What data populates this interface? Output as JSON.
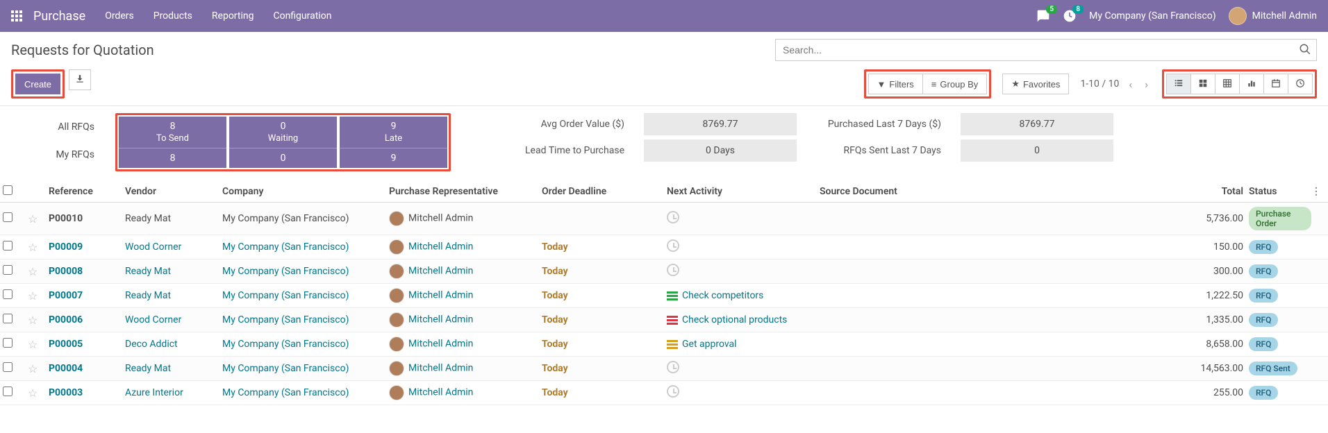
{
  "topbar": {
    "brand": "Purchase",
    "menu": [
      "Orders",
      "Products",
      "Reporting",
      "Configuration"
    ],
    "msg_badge": "5",
    "activity_badge": "8",
    "company": "My Company (San Francisco)",
    "user": "Mitchell Admin"
  },
  "cp": {
    "title": "Requests for Quotation",
    "search_placeholder": "Search...",
    "create": "Create",
    "filters": "Filters",
    "groupby": "Group By",
    "favorites": "Favorites",
    "pager": "1-10 / 10"
  },
  "dash": {
    "left": [
      "All RFQs",
      "My RFQs"
    ],
    "tiles": [
      {
        "big": "8",
        "label": "To Send",
        "sub": "8"
      },
      {
        "big": "0",
        "label": "Waiting",
        "sub": "0"
      },
      {
        "big": "9",
        "label": "Late",
        "sub": "9"
      }
    ],
    "metrics": [
      {
        "label": "Avg Order Value ($)",
        "val": "8769.77"
      },
      {
        "label": "Purchased Last 7 Days ($)",
        "val": "8769.77"
      },
      {
        "label": "Lead Time to Purchase",
        "val": "0  Days"
      },
      {
        "label": "RFQs Sent Last 7 Days",
        "val": "0"
      }
    ]
  },
  "table": {
    "headers": [
      "Reference",
      "Vendor",
      "Company",
      "Purchase Representative",
      "Order Deadline",
      "Next Activity",
      "Source Document",
      "Total",
      "Status"
    ],
    "rows": [
      {
        "ref": "P00010",
        "ref_link": false,
        "vendor": "Ready Mat",
        "vendor_link": false,
        "company": "My Company (San Francisco)",
        "company_link": false,
        "rep": "Mitchell Admin",
        "rep_link": false,
        "deadline": "",
        "deadline_today": false,
        "activity": "",
        "activity_type": "clock",
        "source": "",
        "total": "5,736.00",
        "status": "Purchase Order",
        "status_class": "po"
      },
      {
        "ref": "P00009",
        "ref_link": true,
        "vendor": "Wood Corner",
        "vendor_link": true,
        "company": "My Company (San Francisco)",
        "company_link": true,
        "rep": "Mitchell Admin",
        "rep_link": true,
        "deadline": "Today",
        "deadline_today": true,
        "activity": "",
        "activity_type": "clock",
        "source": "",
        "total": "150.00",
        "status": "RFQ",
        "status_class": "rfq"
      },
      {
        "ref": "P00008",
        "ref_link": true,
        "vendor": "Ready Mat",
        "vendor_link": true,
        "company": "My Company (San Francisco)",
        "company_link": true,
        "rep": "Mitchell Admin",
        "rep_link": true,
        "deadline": "Today",
        "deadline_today": true,
        "activity": "",
        "activity_type": "clock",
        "source": "",
        "total": "300.00",
        "status": "RFQ",
        "status_class": "rfq"
      },
      {
        "ref": "P00007",
        "ref_link": true,
        "vendor": "Ready Mat",
        "vendor_link": true,
        "company": "My Company (San Francisco)",
        "company_link": true,
        "rep": "Mitchell Admin",
        "rep_link": true,
        "deadline": "Today",
        "deadline_today": true,
        "activity": "Check competitors",
        "activity_type": "green",
        "source": "",
        "total": "1,222.50",
        "status": "RFQ",
        "status_class": "rfq"
      },
      {
        "ref": "P00006",
        "ref_link": true,
        "vendor": "Wood Corner",
        "vendor_link": true,
        "company": "My Company (San Francisco)",
        "company_link": true,
        "rep": "Mitchell Admin",
        "rep_link": true,
        "deadline": "Today",
        "deadline_today": true,
        "activity": "Check optional products",
        "activity_type": "red",
        "source": "",
        "total": "1,335.00",
        "status": "RFQ",
        "status_class": "rfq"
      },
      {
        "ref": "P00005",
        "ref_link": true,
        "vendor": "Deco Addict",
        "vendor_link": true,
        "company": "My Company (San Francisco)",
        "company_link": true,
        "rep": "Mitchell Admin",
        "rep_link": true,
        "deadline": "Today",
        "deadline_today": true,
        "activity": "Get approval",
        "activity_type": "amber",
        "source": "",
        "total": "8,658.00",
        "status": "RFQ",
        "status_class": "rfq"
      },
      {
        "ref": "P00004",
        "ref_link": true,
        "vendor": "Ready Mat",
        "vendor_link": true,
        "company": "My Company (San Francisco)",
        "company_link": true,
        "rep": "Mitchell Admin",
        "rep_link": true,
        "deadline": "Today",
        "deadline_today": true,
        "activity": "",
        "activity_type": "clock",
        "source": "",
        "total": "14,563.00",
        "status": "RFQ Sent",
        "status_class": "rfqsent"
      },
      {
        "ref": "P00003",
        "ref_link": true,
        "vendor": "Azure Interior",
        "vendor_link": true,
        "company": "My Company (San Francisco)",
        "company_link": true,
        "rep": "Mitchell Admin",
        "rep_link": true,
        "deadline": "Today",
        "deadline_today": true,
        "activity": "",
        "activity_type": "clock",
        "source": "",
        "total": "255.00",
        "status": "RFQ",
        "status_class": "rfq"
      }
    ]
  }
}
